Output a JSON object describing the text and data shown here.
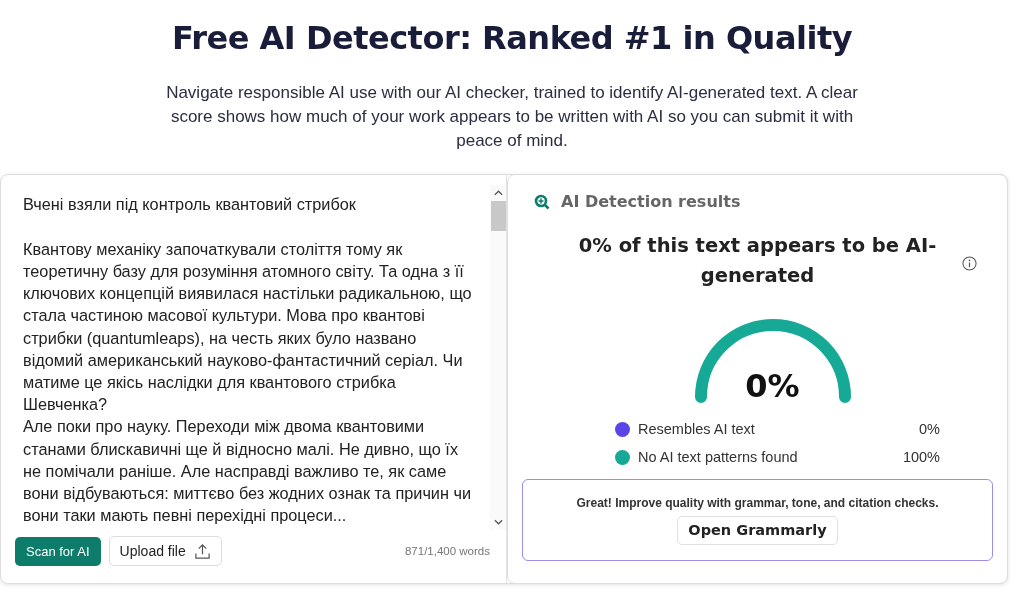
{
  "header": {
    "title": "Free AI Detector: Ranked #1 in Quality",
    "subtitle": "Navigate responsible AI use with our AI checker, trained to identify AI-generated text. A clear score shows how much of your work appears to be written with AI so you can submit it with peace of mind."
  },
  "editor": {
    "heading": "Вчені взяли під контроль квантовий стрибок",
    "paragraphs": [
      "Квантову механіку започаткували століття тому як теоретичну базу для розуміння атомного світу. Та одна з її ключових концепцій виявилася настільки радикальною, що стала частиною масової культури. Мова про квантові стрибки (quantumleaps), на честь яких було названо відомий американський науково-фантастичний серіал. Чи матиме це якісь наслідки для квантового стрибка Шевченка?",
      "Але поки про науку. Переходи між двома квантовими станами блискавичні ще й відносно малі. Не дивно, що їх не помічали раніше. Але насправді важливо те, як саме вони відбуваються: миттєво без жодних ознак та причин чи вони таки мають певні перехідні процеси..."
    ],
    "scan_button": "Scan for AI",
    "upload_button": "Upload file",
    "word_count": "871/1,400 words"
  },
  "results": {
    "title": "AI Detection results",
    "headline": "0% of this text appears to be AI-generated",
    "gauge": {
      "reading": "0%"
    },
    "legend": [
      {
        "label": "Resembles AI text",
        "value": "0%",
        "color": "#5b45e6"
      },
      {
        "label": "No AI text patterns found",
        "value": "100%",
        "color": "#16a996"
      }
    ],
    "promo": {
      "text": "Great! Improve quality with grammar, tone, and citation checks.",
      "button": "Open Grammarly"
    }
  }
}
